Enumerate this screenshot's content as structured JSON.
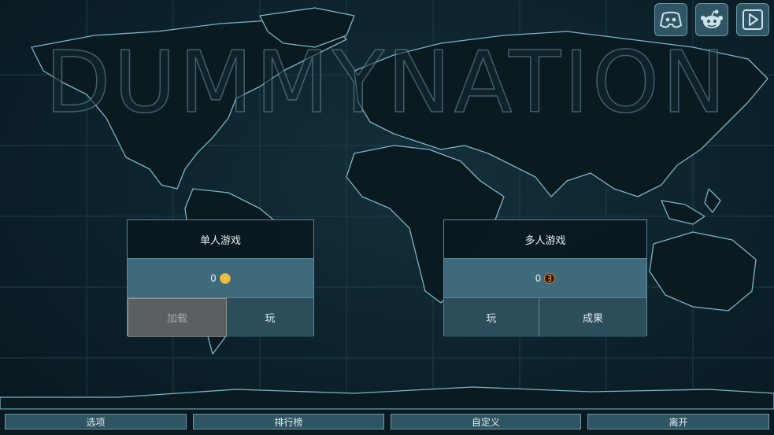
{
  "game_title": "DUMMYNATION",
  "top_icons": [
    {
      "icon": "discord-icon"
    },
    {
      "icon": "reddit-icon"
    },
    {
      "icon": "play-icon"
    }
  ],
  "single_player": {
    "title": "单人游戏",
    "currency_value": "0",
    "currency_icon": "gold-coin-icon",
    "load_label": "加载",
    "play_label": "玩"
  },
  "multiplayer": {
    "title": "多人游戏",
    "currency_value": "0",
    "currency_icon": "bronze-token-icon",
    "play_label": "玩",
    "achievements_label": "成果"
  },
  "bottom_menu": {
    "options_label": "选项",
    "leaderboard_label": "排行榜",
    "customize_label": "自定义",
    "quit_label": "离开"
  },
  "colors": {
    "background": "#0c212b",
    "panel_accent": "#3e6a7b",
    "button": "#2c4e5b",
    "disabled_button": "#5a5f61"
  }
}
